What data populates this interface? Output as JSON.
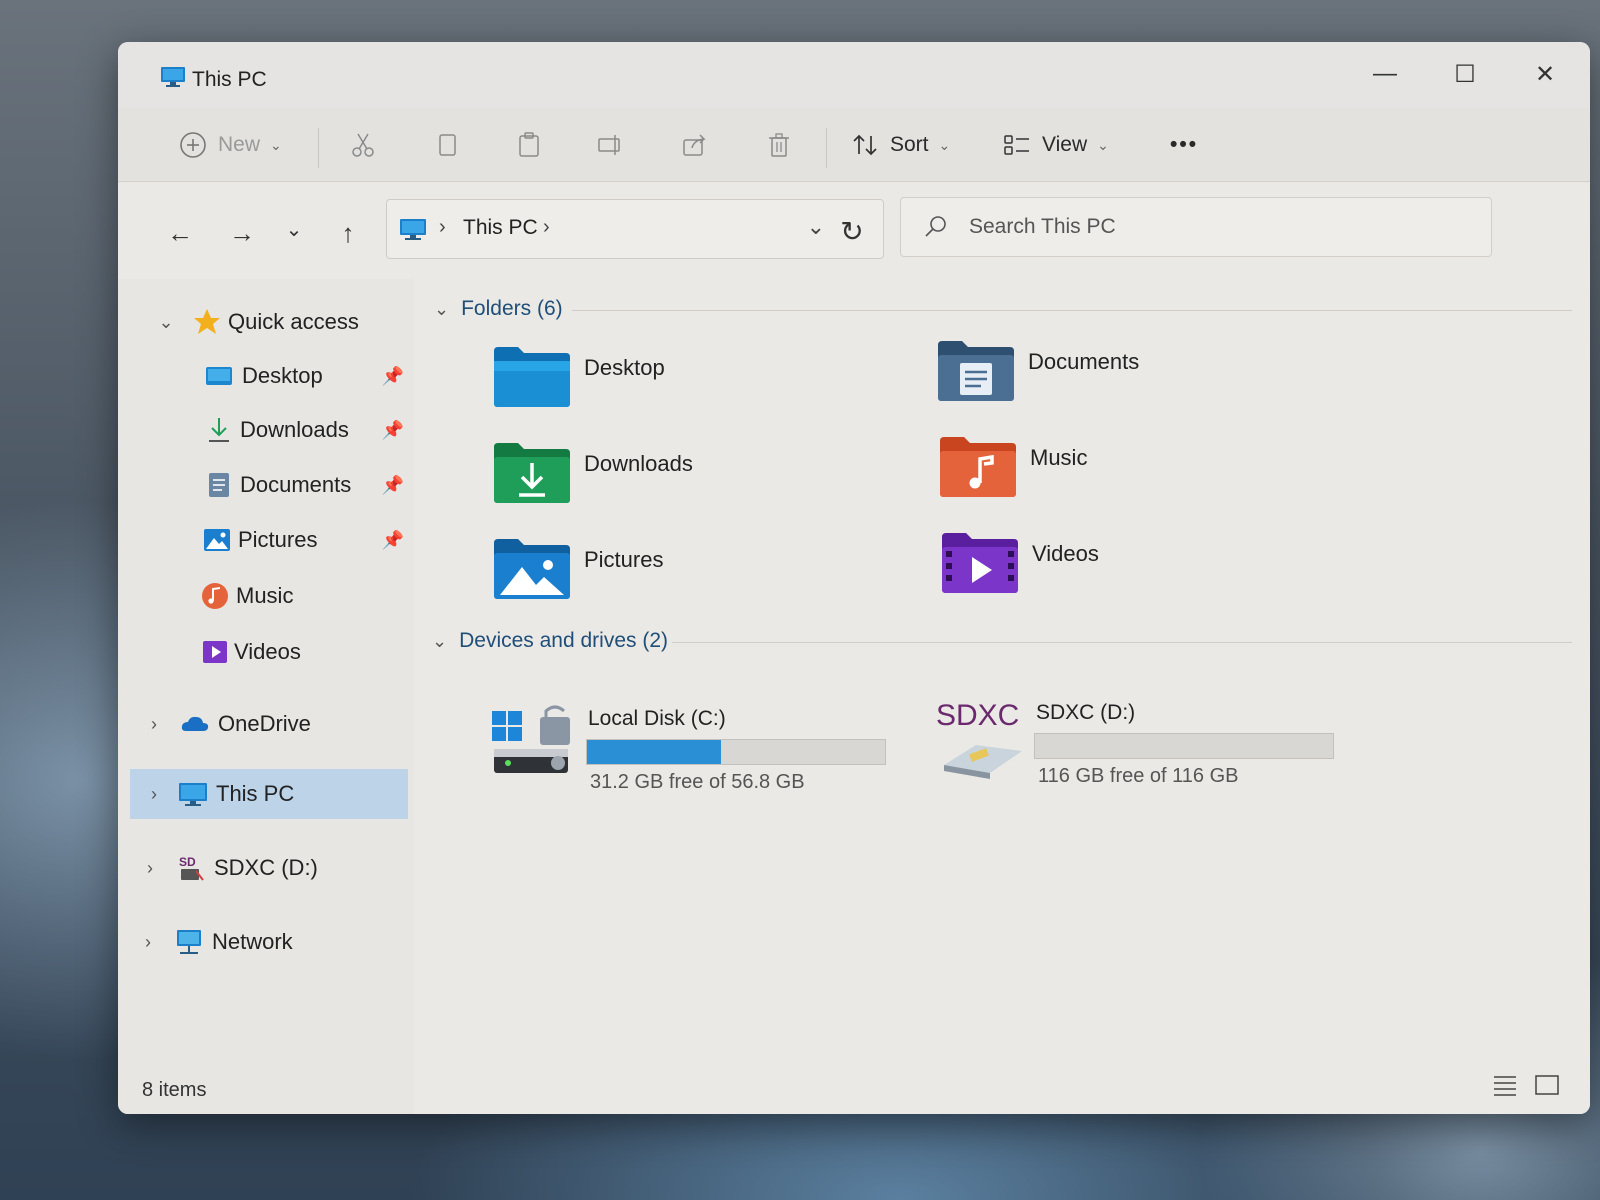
{
  "window": {
    "title": "This PC",
    "minimize_glyph": "—",
    "maximize_glyph": "☐",
    "close_glyph": "✕"
  },
  "toolbar": {
    "new_label": "New",
    "sort_label": "Sort",
    "view_label": "View",
    "more_glyph": "•••"
  },
  "navigation": {
    "back_glyph": "←",
    "forward_glyph": "→",
    "recent_glyph": "⌄",
    "up_glyph": "↑"
  },
  "address": {
    "crumb": "This PC",
    "separator": "›"
  },
  "search": {
    "placeholder": "Search This PC"
  },
  "sidebar": {
    "items": [
      {
        "label": "Quick access",
        "icon": "star-icon",
        "expander": "⌄"
      },
      {
        "label": "Desktop",
        "icon": "desktop-icon",
        "pinned": true
      },
      {
        "label": "Downloads",
        "icon": "download-icon",
        "pinned": true
      },
      {
        "label": "Documents",
        "icon": "document-icon",
        "pinned": true
      },
      {
        "label": "Pictures",
        "icon": "picture-icon",
        "pinned": true
      },
      {
        "label": "Music",
        "icon": "music-icon",
        "pinned": false
      },
      {
        "label": "Videos",
        "icon": "video-icon",
        "pinned": false
      },
      {
        "label": "OneDrive",
        "icon": "cloud-icon",
        "expander": "›"
      },
      {
        "label": "This PC",
        "icon": "computer-icon",
        "expander": "›",
        "selected": true
      },
      {
        "label": "SDXC (D:)",
        "icon": "sd-card-icon",
        "expander": "›"
      },
      {
        "label": "Network",
        "icon": "network-icon",
        "expander": "›"
      }
    ],
    "pin_glyph": "📌"
  },
  "content": {
    "folders_header": "Folders (6)",
    "folders": [
      {
        "label": "Desktop",
        "icon": "desktop-folder-icon",
        "color": "#1a8fd4"
      },
      {
        "label": "Documents",
        "icon": "documents-folder-icon",
        "color": "#4a6f93"
      },
      {
        "label": "Downloads",
        "icon": "downloads-folder-icon",
        "color": "#1e9e58"
      },
      {
        "label": "Music",
        "icon": "music-folder-icon",
        "color": "#e5633a"
      },
      {
        "label": "Pictures",
        "icon": "pictures-folder-icon",
        "color": "#1b7fd0"
      },
      {
        "label": "Videos",
        "icon": "videos-folder-icon",
        "color": "#7b35c9"
      }
    ],
    "drives_header": "Devices and drives (2)",
    "drives": [
      {
        "label": "Local Disk (C:)",
        "free_text": "31.2 GB free of 56.8 GB",
        "used_fraction": 0.45,
        "icon": "system-drive-icon"
      },
      {
        "label": "SDXC (D:)",
        "free_text": "116 GB free of 116 GB",
        "used_fraction": 0.0,
        "icon": "sdxc-card-icon",
        "logo_text": "SDXC"
      }
    ]
  },
  "statusbar": {
    "item_count": "8 items"
  },
  "colors": {
    "accent": "#2b8fd6",
    "selection": "#bcd3e8",
    "group_header": "#1f4e79"
  }
}
